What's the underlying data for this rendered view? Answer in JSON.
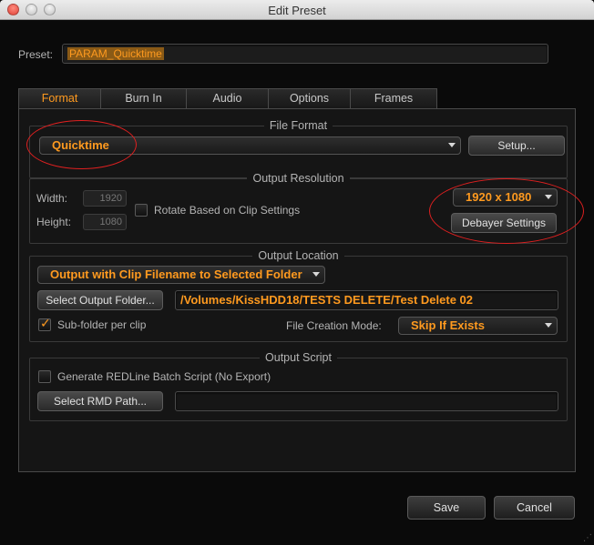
{
  "window": {
    "title": "Edit Preset"
  },
  "preset": {
    "label": "Preset:",
    "value": "PARAM_Quicktime"
  },
  "tabs": [
    {
      "label": "Format"
    },
    {
      "label": "Burn In"
    },
    {
      "label": "Audio"
    },
    {
      "label": "Options"
    },
    {
      "label": "Frames"
    }
  ],
  "active_tab": "Format",
  "file_format": {
    "title": "File Format",
    "format_value": "Quicktime",
    "setup_label": "Setup..."
  },
  "output_resolution": {
    "title": "Output Resolution",
    "width_label": "Width:",
    "width_value": "1920",
    "height_label": "Height:",
    "height_value": "1080",
    "rotate_label": "Rotate Based on Clip Settings",
    "rotate_checked": false,
    "resolution_value": "1920 x 1080",
    "debayer_label": "Debayer Settings"
  },
  "output_location": {
    "title": "Output Location",
    "mode_value": "Output with Clip Filename to Selected Folder",
    "select_folder_label": "Select Output Folder...",
    "folder_path": "/Volumes/KissHDD18/TESTS DELETE/Test Delete 02",
    "subfolder_label": "Sub-folder per clip",
    "subfolder_checked": true,
    "creation_mode_label": "File Creation Mode:",
    "creation_mode_value": "Skip If Exists"
  },
  "output_script": {
    "title": "Output Script",
    "generate_label": "Generate REDLine Batch Script (No Export)",
    "generate_checked": false,
    "select_rmd_label": "Select RMD Path...",
    "rmd_path": ""
  },
  "buttons": {
    "save": "Save",
    "cancel": "Cancel"
  },
  "colors": {
    "accent": "#ff9a1f",
    "annotation": "#e02020",
    "background": "#0a0a0a"
  }
}
